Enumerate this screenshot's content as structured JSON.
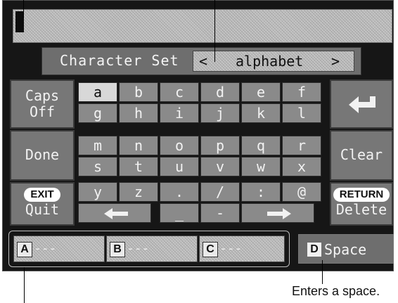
{
  "charset": {
    "label": "Character Set",
    "left_arrow": "<",
    "value": "alphabet",
    "right_arrow": ">"
  },
  "side_left": {
    "caps": {
      "line1": "Caps",
      "line2": "Off"
    },
    "done": "Done",
    "exit": {
      "badge": "EXIT",
      "label": "Quit"
    }
  },
  "side_right": {
    "enter_icon": "return-arrow-icon",
    "clear": "Clear",
    "return": {
      "badge": "RETURN",
      "label": "Delete"
    }
  },
  "keys": {
    "row1": [
      "a",
      "b",
      "c",
      "d",
      "e",
      "f"
    ],
    "row2": [
      "g",
      "h",
      "i",
      "j",
      "k",
      "l"
    ],
    "row3": [
      "m",
      "n",
      "o",
      "p",
      "q",
      "r"
    ],
    "row4": [
      "s",
      "t",
      "u",
      "v",
      "w",
      "x"
    ],
    "row5": [
      "y",
      "z",
      ".",
      "/",
      ":",
      "@"
    ],
    "row6_mid": [
      "_",
      "-"
    ]
  },
  "slots": [
    {
      "key": "A",
      "text": "---"
    },
    {
      "key": "B",
      "text": "---"
    },
    {
      "key": "C",
      "text": "---"
    }
  ],
  "space": {
    "key": "D",
    "label": "Space"
  },
  "caption": "Enters a space."
}
